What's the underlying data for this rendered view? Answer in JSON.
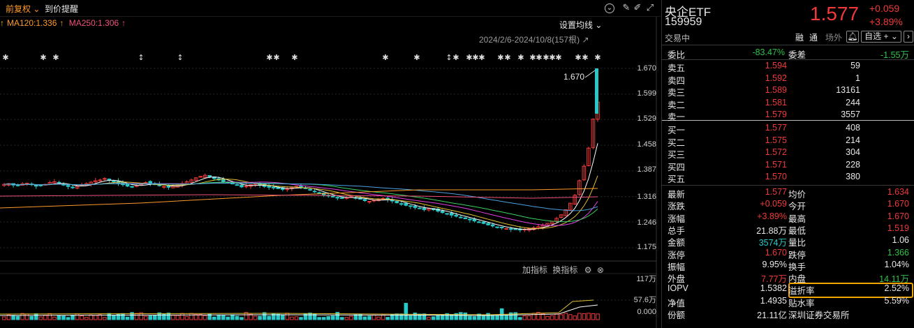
{
  "toolbar": {
    "adjust_label": "前复权",
    "alert_label": "到价提醒"
  },
  "ma": [
    {
      "label": "MA120:1.336",
      "arrow": "↑",
      "color": "#ff9a2a"
    },
    {
      "label": "MA250:1.306",
      "arrow": "↑",
      "color": "#f0507a"
    }
  ],
  "ma_arrow_first": "↑",
  "settings_label": "设置均线",
  "date_range": "2024/2/6-2024/10/8(157根)",
  "high_label": "1.670",
  "price_ticks": [
    "1.670",
    "1.599",
    "1.529",
    "1.458",
    "1.387",
    "1.316",
    "1.246",
    "1.175"
  ],
  "indicator": {
    "add_label": "加指标",
    "swap_label": "换指标"
  },
  "vol_ticks": [
    "117万",
    "57.6万",
    "0.000"
  ],
  "quote": {
    "name": "央企ETF",
    "code": "159959",
    "price": "1.577",
    "change": "+0.059",
    "change_pct": "+3.89%",
    "status": "交易中",
    "tag_rong": "融",
    "tag_tong": "通",
    "tag_changwai": "场外",
    "watch_label": "自选 +"
  },
  "order_ratio": {
    "label1": "委比",
    "value1": "-83.47%",
    "label2": "委差",
    "value2": "-1.55万"
  },
  "asks": [
    {
      "label": "卖五",
      "price": "1.594",
      "vol": "59"
    },
    {
      "label": "卖四",
      "price": "1.592",
      "vol": "1"
    },
    {
      "label": "卖三",
      "price": "1.589",
      "vol": "13161"
    },
    {
      "label": "卖二",
      "price": "1.581",
      "vol": "244"
    },
    {
      "label": "卖一",
      "price": "1.579",
      "vol": "3557"
    }
  ],
  "bids": [
    {
      "label": "买一",
      "price": "1.577",
      "vol": "408"
    },
    {
      "label": "买二",
      "price": "1.575",
      "vol": "214"
    },
    {
      "label": "买三",
      "price": "1.572",
      "vol": "304"
    },
    {
      "label": "买四",
      "price": "1.571",
      "vol": "228"
    },
    {
      "label": "买五",
      "price": "1.570",
      "vol": "380"
    }
  ],
  "stats": [
    {
      "l1": "最新",
      "v1": "1.577",
      "c1": "red",
      "l2": "均价",
      "v2": "1.634",
      "c2": "red"
    },
    {
      "l1": "涨跌",
      "v1": "+0.059",
      "c1": "red",
      "l2": "今开",
      "v2": "1.670",
      "c2": "red"
    },
    {
      "l1": "涨幅",
      "v1": "+3.89%",
      "c1": "red",
      "l2": "最高",
      "v2": "1.670",
      "c2": "red"
    },
    {
      "l1": "总手",
      "v1": "21.88万",
      "c1": "white",
      "l2": "最低",
      "v2": "1.519",
      "c2": "red"
    },
    {
      "l1": "金额",
      "v1": "3574万",
      "c1": "cyan",
      "l2": "量比",
      "v2": "1.06",
      "c2": "white"
    },
    {
      "l1": "涨停",
      "v1": "1.670",
      "c1": "red",
      "l2": "跌停",
      "v2": "1.366",
      "c2": "green"
    },
    {
      "l1": "振幅",
      "v1": "9.95%",
      "c1": "white",
      "l2": "换手",
      "v2": "1.04%",
      "c2": "white"
    },
    {
      "l1": "外盘",
      "v1": "7.77万",
      "c1": "red",
      "l2": "内盘",
      "v2": "14.11万",
      "c2": "green"
    },
    {
      "l1": "IOPV",
      "v1": "1.5382",
      "c1": "white",
      "l2": "溢折率",
      "v2": "2.52%",
      "c2": "white"
    },
    {
      "l1": "净值",
      "v1": "1.4935",
      "c1": "white",
      "l2": "贴水率",
      "v2": "5.59%",
      "c2": "white"
    },
    {
      "l1": "份额",
      "v1": "21.11亿",
      "c1": "white",
      "l2": "深圳证券交易所",
      "v2": "",
      "c2": "white"
    }
  ],
  "chart_data": {
    "type": "candlestick",
    "date_range": "2024/2/6-2024/10/8",
    "bars": 157,
    "ylim": [
      1.175,
      1.67
    ],
    "last_high": 1.67,
    "price_ticks": [
      1.67,
      1.599,
      1.529,
      1.458,
      1.387,
      1.316,
      1.246,
      1.175
    ],
    "close_path": [
      1.35,
      1.352,
      1.348,
      1.346,
      1.351,
      1.353,
      1.349,
      1.345,
      1.347,
      1.35,
      1.355,
      1.357,
      1.352,
      1.348,
      1.344,
      1.341,
      1.345,
      1.349,
      1.352,
      1.356,
      1.36,
      1.362,
      1.366,
      1.361,
      1.357,
      1.353,
      1.349,
      1.345,
      1.343,
      1.347,
      1.351,
      1.355,
      1.352,
      1.349,
      1.346,
      1.344,
      1.342,
      1.345,
      1.348,
      1.352,
      1.357,
      1.362,
      1.368,
      1.372,
      1.375,
      1.371,
      1.366,
      1.362,
      1.357,
      1.354,
      1.351,
      1.347,
      1.343,
      1.345,
      1.349,
      1.352,
      1.348,
      1.344,
      1.342,
      1.34,
      1.338,
      1.336,
      1.338,
      1.341,
      1.345,
      1.342,
      1.338,
      1.334,
      1.33,
      1.325,
      1.321,
      1.318,
      1.315,
      1.313,
      1.311,
      1.314,
      1.316,
      1.312,
      1.309,
      1.305,
      1.303,
      1.306,
      1.309,
      1.311,
      1.308,
      1.304,
      1.299,
      1.295,
      1.292,
      1.289,
      1.286,
      1.283,
      1.28,
      1.283,
      1.28,
      1.276,
      1.272,
      1.268,
      1.265,
      1.262,
      1.259,
      1.255,
      1.252,
      1.249,
      1.246,
      1.242,
      1.238,
      1.235,
      1.232,
      1.23,
      1.228,
      1.226,
      1.225,
      1.224,
      1.226,
      1.228,
      1.23,
      1.233,
      1.237,
      1.242,
      1.248,
      1.256,
      1.266,
      1.28,
      1.298,
      1.32,
      1.36,
      1.4,
      1.45,
      1.53,
      1.577
    ],
    "volume_ticks": [
      "117万",
      "57.6万",
      "0.000"
    ]
  }
}
